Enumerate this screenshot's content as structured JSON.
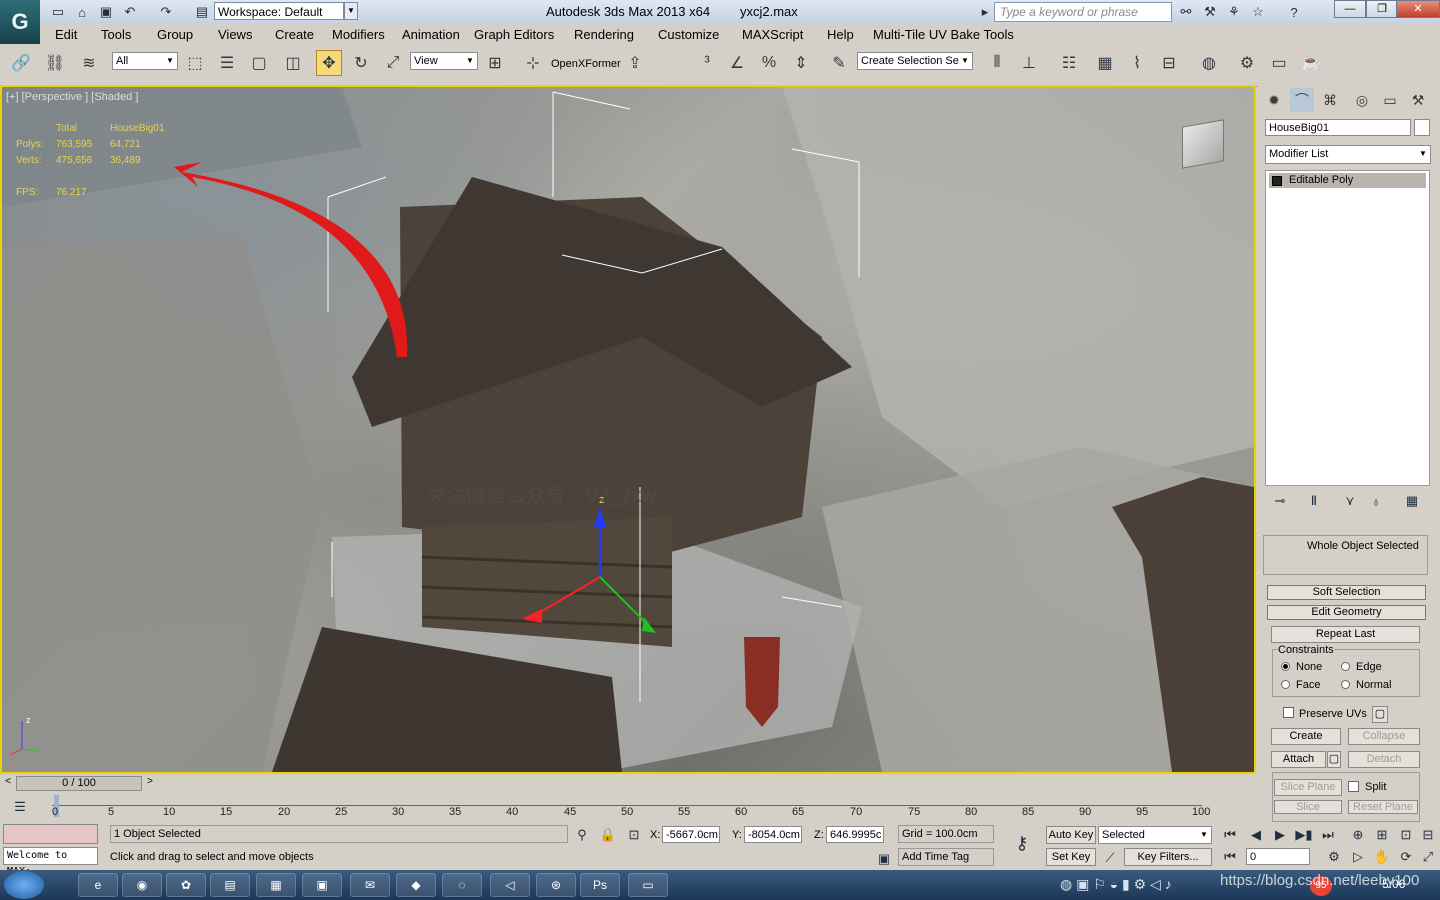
{
  "app": {
    "logo": "G",
    "workspace": "Workspace: Default",
    "title": "Autodesk 3ds Max  2013 x64",
    "filename": "yxcj2.max",
    "keyword_placeholder": "Type a keyword or phrase"
  },
  "menu": [
    "Edit",
    "Tools",
    "Group",
    "Views",
    "Create",
    "Modifiers",
    "Animation",
    "Graph Editors",
    "Rendering",
    "Customize",
    "MAXScript",
    "Help",
    "Multi-Tile UV Bake Tools"
  ],
  "toolbar": {
    "selection_filter": "All",
    "ref_coord": "View",
    "openx_label": "OpenXFormer",
    "named_selection": "Create Selection Se"
  },
  "viewport": {
    "label": "[+] [Perspective ] [Shaded ]",
    "stats": {
      "header_total": "Total",
      "header_obj": "HouseBig01",
      "polys_label": "Polys:",
      "polys_total": "763,595",
      "polys_obj": "64,721",
      "verts_label": "Verts:",
      "verts_total": "475,656",
      "verts_obj": "36,489",
      "fps_label": "FPS:",
      "fps_value": "76.217"
    },
    "watermark": "关注微信公众号：V2_zxw"
  },
  "command_panel": {
    "object_name": "HouseBig01",
    "modifier_list": "Modifier List",
    "stack_item": "Editable Poly",
    "selection_info": "Whole Object Selected",
    "rollouts": {
      "soft": "Soft Selection",
      "edit": "Edit Geometry"
    },
    "repeat_last": "Repeat Last",
    "constraints_label": "Constraints",
    "constraints": {
      "none": "None",
      "edge": "Edge",
      "face": "Face",
      "normal": "Normal"
    },
    "preserve_uvs": "Preserve UVs",
    "create": "Create",
    "collapse": "Collapse",
    "attach": "Attach",
    "detach": "Detach",
    "slice_plane": "Slice Plane",
    "split": "Split",
    "slice": "Slice",
    "reset_plane": "Reset Plane"
  },
  "timeline": {
    "frame": "0 / 100",
    "ticks": [
      "0",
      "5",
      "10",
      "15",
      "20",
      "25",
      "30",
      "35",
      "40",
      "45",
      "50",
      "55",
      "60",
      "65",
      "70",
      "75",
      "80",
      "85",
      "90",
      "95",
      "100"
    ]
  },
  "status": {
    "maxscript": "Welcome to MAX:",
    "selected": "1 Object Selected",
    "prompt": "Click and drag to select and move objects",
    "x_label": "X:",
    "x": "-5667.0cm",
    "y_label": "Y:",
    "y": "-8054.0cm",
    "z_label": "Z:",
    "z": "646.9995c",
    "grid": "Grid = 100.0cm",
    "add_time_tag": "Add Time Tag",
    "auto_key": "Auto Key",
    "set_key": "Set Key",
    "key_mode": "Selected",
    "key_filters": "Key Filters...",
    "current_frame": "0"
  },
  "taskbar": {
    "watermark_url": "https://blog.csdn.net/leeby100",
    "time": "5:06",
    "badge": "95"
  }
}
